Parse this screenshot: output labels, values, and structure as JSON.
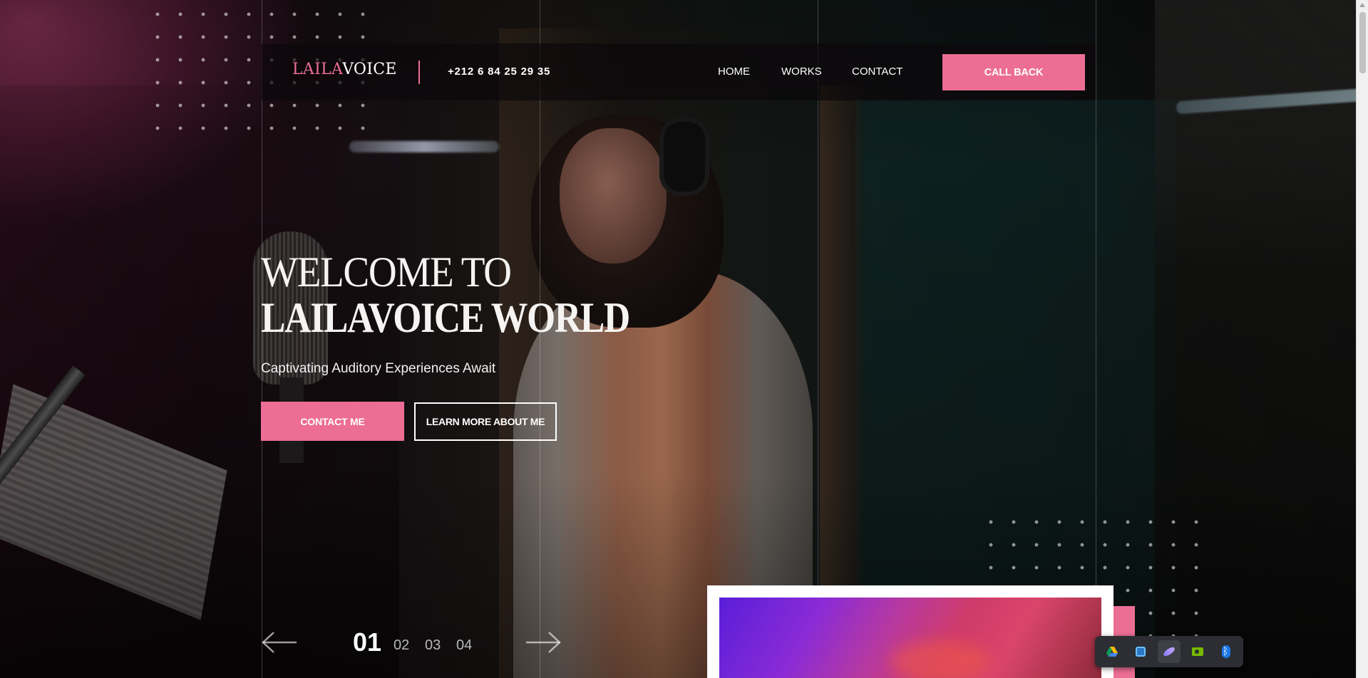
{
  "header": {
    "logo_part1": "LAILA",
    "logo_part2": "VOICE",
    "phone": "+212 6 84 25 29 35",
    "nav": [
      "HOME",
      "WORKS",
      "CONTACT"
    ],
    "cta": "CALL BACK"
  },
  "hero": {
    "title_line1": "WELCOME TO",
    "title_line2": "LAILAVOICE WORLD",
    "subtitle": "Captivating Auditory Experiences Await",
    "primary_button": "CONTACT ME",
    "secondary_button": "LEARN MORE ABOUT ME"
  },
  "slider": {
    "active": "01",
    "others": [
      "02",
      "03",
      "04"
    ]
  },
  "tray": {
    "icons": [
      "google-drive-icon",
      "app-window-icon",
      "feather-icon",
      "nvidia-icon",
      "bluetooth-icon"
    ]
  },
  "colors": {
    "accent": "#ec6e95",
    "header_bg": "#0c080a",
    "tray_bg": "#2c2e33"
  }
}
